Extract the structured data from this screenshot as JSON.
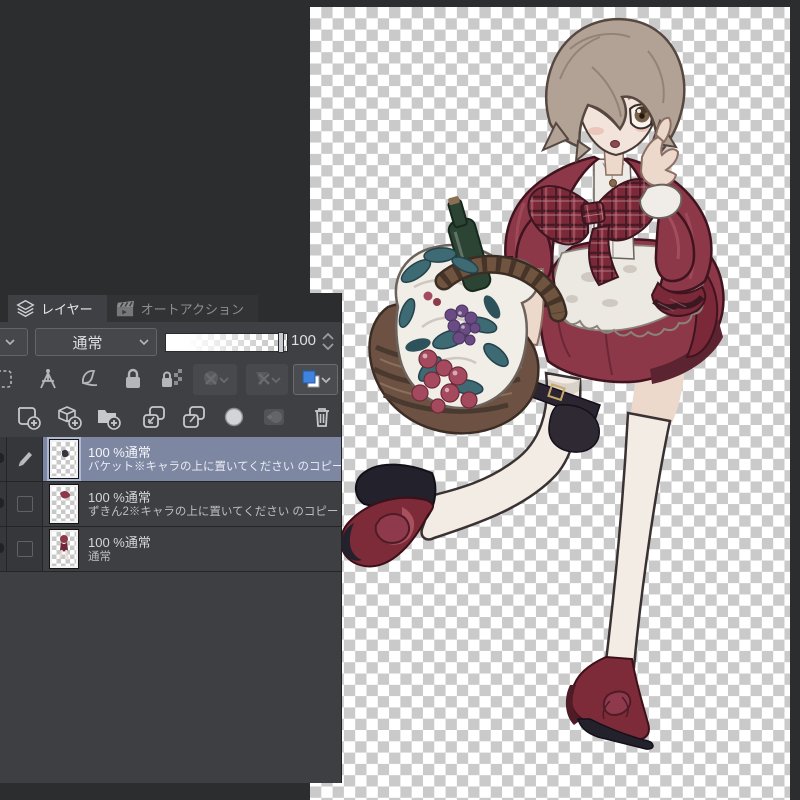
{
  "canvas": {
    "alt": "赤ずきん風の少女キャラクター(透明背景チェッカー上)"
  },
  "panel": {
    "tabs": [
      {
        "label": "レイヤー",
        "icon": "layers-icon",
        "active": true
      },
      {
        "label": "オートアクション",
        "icon": "clapperboard-icon",
        "active": false
      }
    ],
    "blend": {
      "mode": "通常",
      "opacity": "100"
    },
    "layers": [
      {
        "info": "100 %通常",
        "name": "バケット※キャラの上に置いてください のコピー",
        "selected": true,
        "editing": true
      },
      {
        "info": "100 %通常",
        "name": "ずきん2※キャラの上に置いてください のコピー",
        "selected": false
      },
      {
        "info": "100 %通常",
        "name": "通常",
        "selected": false
      }
    ]
  },
  "colors": {
    "app_bg": "#2b2d2e",
    "panel_bg": "#3e4043",
    "selected_row": "#7d87a2",
    "layer_color_accent": "#3f82e0",
    "checker_light": "#ffffff",
    "checker_gray": "#cacaca",
    "dress_red": "#8c3848"
  },
  "icons": {
    "tab": [
      "layers-icon",
      "clapperboard-icon"
    ],
    "lock_row": [
      "reference-layer-icon",
      "ruler-snap-icon",
      "draft-layer-icon",
      "lock-icon",
      "lock-alpha-icon",
      "enable-mask-icon",
      "ruler-range-icon",
      "layer-color-swatch"
    ],
    "command_row": [
      "new-raster-layer-icon",
      "new-layer-dialog-icon",
      "new-folder-icon",
      "transfer-down-icon",
      "merge-down-icon",
      "layer-mask-icon",
      "apply-mask-icon",
      "delete-layer-icon"
    ],
    "misc": [
      "chevron-down-icon",
      "spinner-up-icon",
      "spinner-down-icon",
      "pen-icon",
      "eye-icon",
      "checkbox"
    ]
  }
}
